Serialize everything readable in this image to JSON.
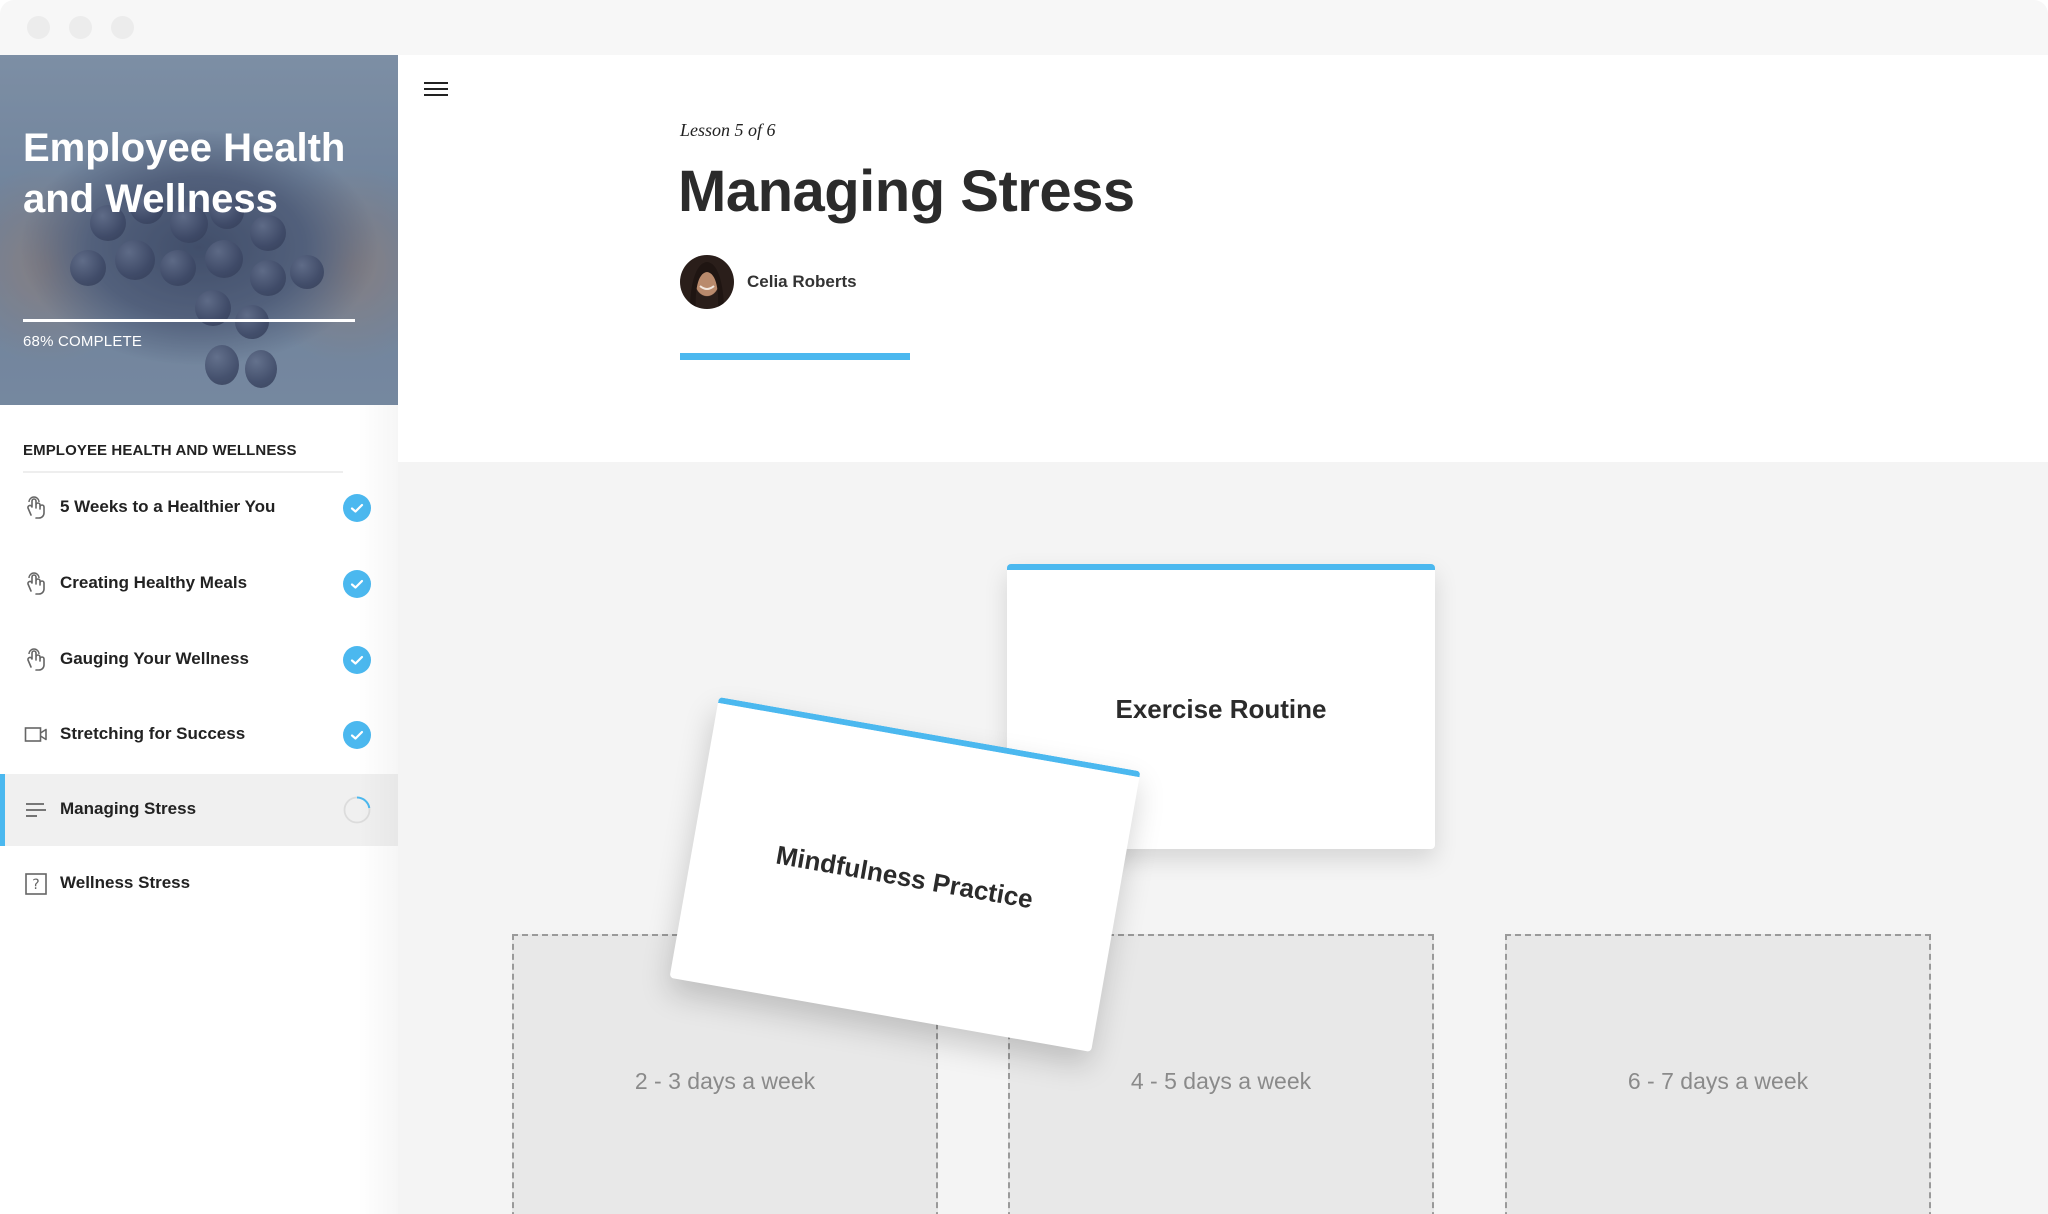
{
  "window": {
    "controls": [
      "close",
      "minimize",
      "maximize"
    ]
  },
  "course": {
    "title": "Employee Health and Wellness",
    "progress_percent": 68,
    "progress_label": "68% COMPLETE",
    "section_heading": "EMPLOYEE HEALTH AND WELLNESS",
    "lessons": [
      {
        "label": "5 Weeks to a Healthier You",
        "icon": "interactive-touch-icon",
        "status": "complete"
      },
      {
        "label": "Creating Healthy Meals",
        "icon": "interactive-touch-icon",
        "status": "complete"
      },
      {
        "label": "Gauging Your Wellness",
        "icon": "interactive-touch-icon",
        "status": "complete"
      },
      {
        "label": "Stretching for Success",
        "icon": "video-icon",
        "status": "complete"
      },
      {
        "label": "Managing Stress",
        "icon": "text-lines-icon",
        "status": "in-progress",
        "active": true
      },
      {
        "label": "Wellness Stress",
        "icon": "quiz-question-icon",
        "status": "not-started"
      }
    ]
  },
  "lesson": {
    "counter": "Lesson 5 of 6",
    "title": "Managing Stress",
    "author": "Celia Roberts"
  },
  "activity": {
    "cards": [
      {
        "label": "Exercise Routine",
        "state": "stacked"
      },
      {
        "label": "Mindfulness Practice",
        "state": "dragging"
      }
    ],
    "drop_zones": [
      {
        "label": "2 - 3 days a week"
      },
      {
        "label": "4 - 5 days a week"
      },
      {
        "label": "6 - 7 days a week"
      }
    ]
  },
  "colors": {
    "accent": "#4bb8ef",
    "complete_badge": "#4bb8ef",
    "drop_zone_bg": "#e8e8e8",
    "activity_bg": "#f4f4f4"
  }
}
